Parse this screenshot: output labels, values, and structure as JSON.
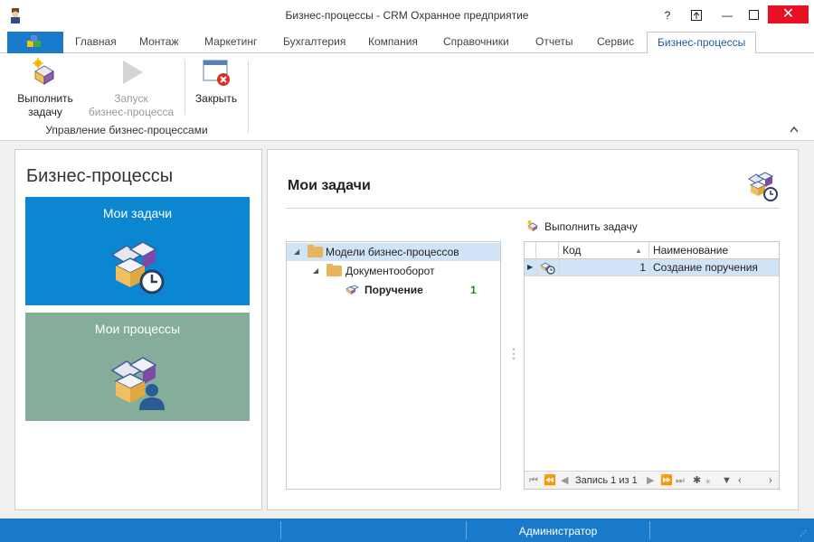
{
  "window": {
    "title": "Бизнес-процессы - CRM Охранное предприятие",
    "help_label": "?",
    "restore_label": "⊡",
    "minimize_label": "—",
    "close_label": "✕"
  },
  "ribbon_tabs": [
    {
      "label": "Главная"
    },
    {
      "label": "Монтаж"
    },
    {
      "label": "Маркетинг"
    },
    {
      "label": "Бухгалтерия"
    },
    {
      "label": "Компания"
    },
    {
      "label": "Справочники"
    },
    {
      "label": "Отчеты"
    },
    {
      "label": "Сервис"
    },
    {
      "label": "Бизнес-процессы",
      "active": true
    }
  ],
  "ribbon": {
    "execute_task_label_1": "Выполнить",
    "execute_task_label_2": "задачу",
    "start_process_label_1": "Запуск",
    "start_process_label_2": "бизнес-процесса",
    "close_label": "Закрыть",
    "group_label": "Управление бизнес-процессами",
    "collapse_icon": "chevron-up-icon"
  },
  "left_panel": {
    "title": "Бизнес-процессы",
    "tiles": [
      {
        "label": "Мои задачи",
        "color": "#0b86d1",
        "icon": "tasks-clock-icon"
      },
      {
        "label": "Мои процессы",
        "color": "#84ad9c",
        "icon": "processes-user-icon"
      }
    ]
  },
  "right_panel": {
    "title": "Мои задачи",
    "execute_link": "Выполнить задачу",
    "tree": [
      {
        "label": "Модели бизнес-процессов",
        "level": 0,
        "selected": true
      },
      {
        "label": "Документооборот",
        "level": 1
      },
      {
        "label": "Поручение",
        "level": 2,
        "count": "1"
      }
    ],
    "grid": {
      "columns": [
        "Код",
        "Наименование"
      ],
      "rows": [
        {
          "code": "1",
          "name": "Создание поручения"
        }
      ],
      "pager_text": "Запись 1 из 1"
    }
  },
  "status_bar": {
    "user": "Администратор"
  },
  "colors": {
    "accent": "#1979ca",
    "tile_blue": "#0b86d1",
    "tile_green": "#84ad9c",
    "selection": "#cfe4f6",
    "close_red": "#e81123"
  }
}
